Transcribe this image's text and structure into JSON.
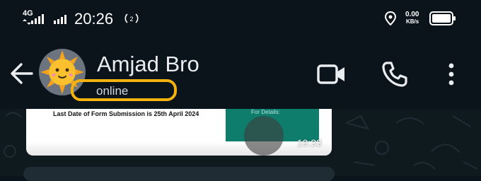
{
  "status_bar": {
    "network_label": "4G",
    "time": "20:26",
    "data_speed_value": "0.00",
    "data_speed_unit": "KB/s"
  },
  "header": {
    "contact_name": "Amjad Bro",
    "presence": "online"
  },
  "message": {
    "document_line": "Last Date of Form Submission is 25th April 2024",
    "overlay_text": "For Details:",
    "timestamp": "19:33"
  },
  "colors": {
    "background": "#0b141a",
    "highlight": "#f3b20e",
    "teal": "#0f7d6c"
  }
}
